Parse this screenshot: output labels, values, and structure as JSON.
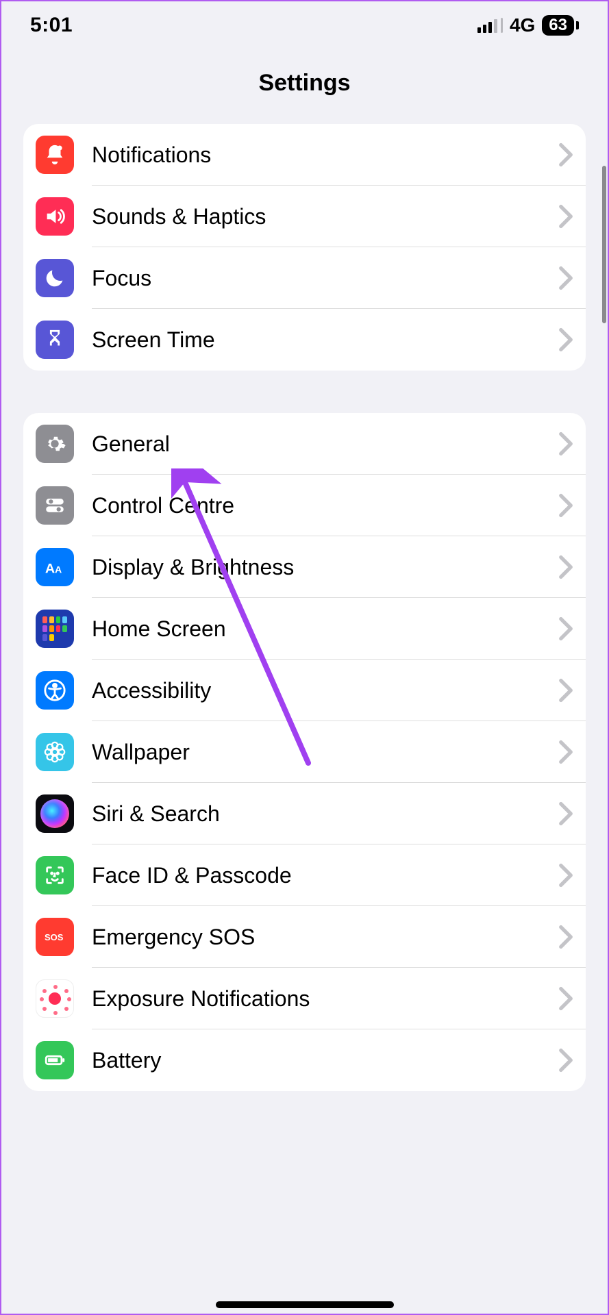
{
  "status_bar": {
    "time": "5:01",
    "network_label": "4G",
    "battery_percent": "63"
  },
  "header": {
    "title": "Settings"
  },
  "groups": [
    {
      "items": [
        {
          "label": "Notifications",
          "icon": "bell",
          "bg": "bg-red"
        },
        {
          "label": "Sounds & Haptics",
          "icon": "speaker",
          "bg": "bg-pink"
        },
        {
          "label": "Focus",
          "icon": "moon",
          "bg": "bg-indigo"
        },
        {
          "label": "Screen Time",
          "icon": "hourglass",
          "bg": "bg-indigo"
        }
      ]
    },
    {
      "items": [
        {
          "label": "General",
          "icon": "gear",
          "bg": "bg-gray"
        },
        {
          "label": "Control Centre",
          "icon": "toggles",
          "bg": "bg-gray"
        },
        {
          "label": "Display & Brightness",
          "icon": "text-size",
          "bg": "bg-blue"
        },
        {
          "label": "Home Screen",
          "icon": "home-grid",
          "bg": "bg-darkblue"
        },
        {
          "label": "Accessibility",
          "icon": "accessibility",
          "bg": "bg-blue"
        },
        {
          "label": "Wallpaper",
          "icon": "flower",
          "bg": "bg-cyan"
        },
        {
          "label": "Siri & Search",
          "icon": "siri",
          "bg": "siri"
        },
        {
          "label": "Face ID & Passcode",
          "icon": "faceid",
          "bg": "bg-green"
        },
        {
          "label": "Emergency SOS",
          "icon": "sos",
          "bg": "bg-red"
        },
        {
          "label": "Exposure Notifications",
          "icon": "exposure",
          "bg": "white"
        },
        {
          "label": "Battery",
          "icon": "battery",
          "bg": "bg-battgr"
        }
      ]
    }
  ],
  "annotation": {
    "target": "General"
  }
}
